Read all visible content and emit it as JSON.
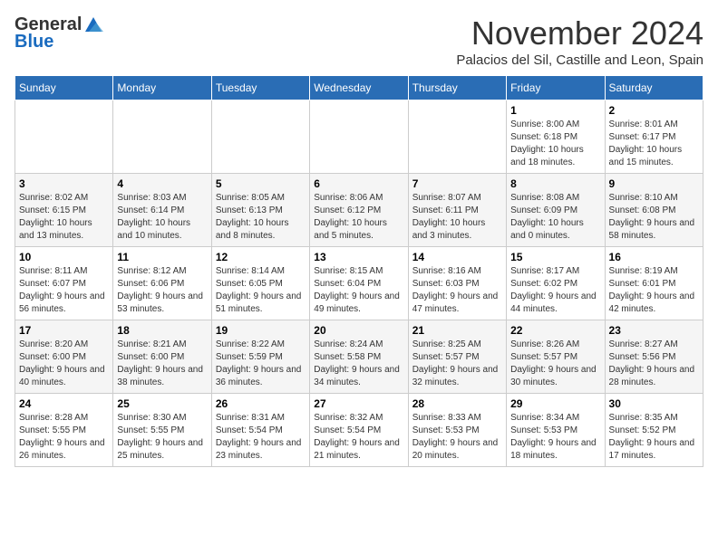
{
  "logo": {
    "general": "General",
    "blue": "Blue"
  },
  "title": "November 2024",
  "subtitle": "Palacios del Sil, Castille and Leon, Spain",
  "days_of_week": [
    "Sunday",
    "Monday",
    "Tuesday",
    "Wednesday",
    "Thursday",
    "Friday",
    "Saturday"
  ],
  "weeks": [
    [
      {
        "day": "",
        "info": ""
      },
      {
        "day": "",
        "info": ""
      },
      {
        "day": "",
        "info": ""
      },
      {
        "day": "",
        "info": ""
      },
      {
        "day": "",
        "info": ""
      },
      {
        "day": "1",
        "info": "Sunrise: 8:00 AM\nSunset: 6:18 PM\nDaylight: 10 hours and 18 minutes."
      },
      {
        "day": "2",
        "info": "Sunrise: 8:01 AM\nSunset: 6:17 PM\nDaylight: 10 hours and 15 minutes."
      }
    ],
    [
      {
        "day": "3",
        "info": "Sunrise: 8:02 AM\nSunset: 6:15 PM\nDaylight: 10 hours and 13 minutes."
      },
      {
        "day": "4",
        "info": "Sunrise: 8:03 AM\nSunset: 6:14 PM\nDaylight: 10 hours and 10 minutes."
      },
      {
        "day": "5",
        "info": "Sunrise: 8:05 AM\nSunset: 6:13 PM\nDaylight: 10 hours and 8 minutes."
      },
      {
        "day": "6",
        "info": "Sunrise: 8:06 AM\nSunset: 6:12 PM\nDaylight: 10 hours and 5 minutes."
      },
      {
        "day": "7",
        "info": "Sunrise: 8:07 AM\nSunset: 6:11 PM\nDaylight: 10 hours and 3 minutes."
      },
      {
        "day": "8",
        "info": "Sunrise: 8:08 AM\nSunset: 6:09 PM\nDaylight: 10 hours and 0 minutes."
      },
      {
        "day": "9",
        "info": "Sunrise: 8:10 AM\nSunset: 6:08 PM\nDaylight: 9 hours and 58 minutes."
      }
    ],
    [
      {
        "day": "10",
        "info": "Sunrise: 8:11 AM\nSunset: 6:07 PM\nDaylight: 9 hours and 56 minutes."
      },
      {
        "day": "11",
        "info": "Sunrise: 8:12 AM\nSunset: 6:06 PM\nDaylight: 9 hours and 53 minutes."
      },
      {
        "day": "12",
        "info": "Sunrise: 8:14 AM\nSunset: 6:05 PM\nDaylight: 9 hours and 51 minutes."
      },
      {
        "day": "13",
        "info": "Sunrise: 8:15 AM\nSunset: 6:04 PM\nDaylight: 9 hours and 49 minutes."
      },
      {
        "day": "14",
        "info": "Sunrise: 8:16 AM\nSunset: 6:03 PM\nDaylight: 9 hours and 47 minutes."
      },
      {
        "day": "15",
        "info": "Sunrise: 8:17 AM\nSunset: 6:02 PM\nDaylight: 9 hours and 44 minutes."
      },
      {
        "day": "16",
        "info": "Sunrise: 8:19 AM\nSunset: 6:01 PM\nDaylight: 9 hours and 42 minutes."
      }
    ],
    [
      {
        "day": "17",
        "info": "Sunrise: 8:20 AM\nSunset: 6:00 PM\nDaylight: 9 hours and 40 minutes."
      },
      {
        "day": "18",
        "info": "Sunrise: 8:21 AM\nSunset: 6:00 PM\nDaylight: 9 hours and 38 minutes."
      },
      {
        "day": "19",
        "info": "Sunrise: 8:22 AM\nSunset: 5:59 PM\nDaylight: 9 hours and 36 minutes."
      },
      {
        "day": "20",
        "info": "Sunrise: 8:24 AM\nSunset: 5:58 PM\nDaylight: 9 hours and 34 minutes."
      },
      {
        "day": "21",
        "info": "Sunrise: 8:25 AM\nSunset: 5:57 PM\nDaylight: 9 hours and 32 minutes."
      },
      {
        "day": "22",
        "info": "Sunrise: 8:26 AM\nSunset: 5:57 PM\nDaylight: 9 hours and 30 minutes."
      },
      {
        "day": "23",
        "info": "Sunrise: 8:27 AM\nSunset: 5:56 PM\nDaylight: 9 hours and 28 minutes."
      }
    ],
    [
      {
        "day": "24",
        "info": "Sunrise: 8:28 AM\nSunset: 5:55 PM\nDaylight: 9 hours and 26 minutes."
      },
      {
        "day": "25",
        "info": "Sunrise: 8:30 AM\nSunset: 5:55 PM\nDaylight: 9 hours and 25 minutes."
      },
      {
        "day": "26",
        "info": "Sunrise: 8:31 AM\nSunset: 5:54 PM\nDaylight: 9 hours and 23 minutes."
      },
      {
        "day": "27",
        "info": "Sunrise: 8:32 AM\nSunset: 5:54 PM\nDaylight: 9 hours and 21 minutes."
      },
      {
        "day": "28",
        "info": "Sunrise: 8:33 AM\nSunset: 5:53 PM\nDaylight: 9 hours and 20 minutes."
      },
      {
        "day": "29",
        "info": "Sunrise: 8:34 AM\nSunset: 5:53 PM\nDaylight: 9 hours and 18 minutes."
      },
      {
        "day": "30",
        "info": "Sunrise: 8:35 AM\nSunset: 5:52 PM\nDaylight: 9 hours and 17 minutes."
      }
    ]
  ]
}
